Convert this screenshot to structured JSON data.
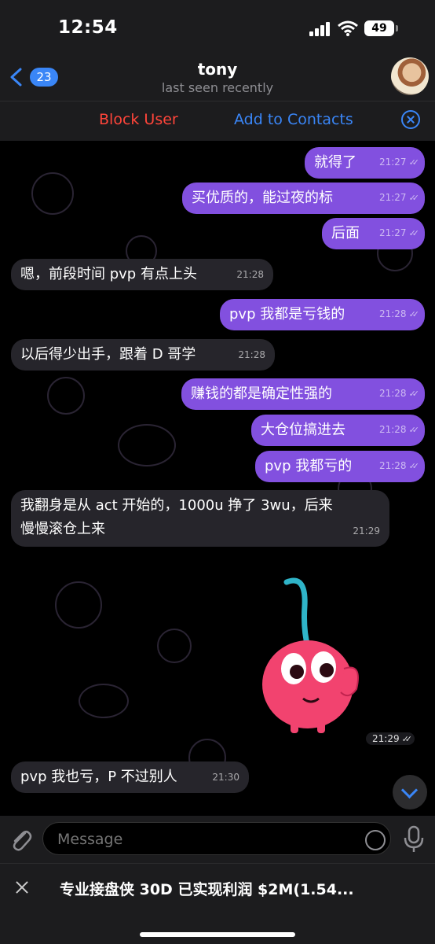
{
  "status": {
    "time": "12:54",
    "battery": "49"
  },
  "header": {
    "back_count": "23",
    "name": "tony",
    "last_seen": "last seen recently"
  },
  "actions": {
    "block": "Block User",
    "add": "Add to Contacts"
  },
  "messages": [
    {
      "dir": "out",
      "text": "就得了",
      "time": "21:27"
    },
    {
      "dir": "out",
      "text": "买优质的，能过夜的标",
      "time": "21:27"
    },
    {
      "dir": "out",
      "text": "后面",
      "time": "21:27"
    },
    {
      "dir": "in",
      "text": "嗯，前段时间 pvp 有点上头",
      "time": "21:28"
    },
    {
      "dir": "out",
      "text": "pvp 我都是亏钱的",
      "time": "21:28"
    },
    {
      "dir": "in",
      "text": "以后得少出手，跟着 D 哥学",
      "time": "21:28"
    },
    {
      "dir": "out",
      "text": "赚钱的都是确定性强的",
      "time": "21:28"
    },
    {
      "dir": "out",
      "text": "大仓位搞进去",
      "time": "21:28"
    },
    {
      "dir": "out",
      "text": "pvp 我都亏的",
      "time": "21:28"
    },
    {
      "dir": "in",
      "text": "我翻身是从 act 开始的，1000u 挣了 3wu，后来",
      "text2": "慢慢滚仓上来",
      "time": "21:29"
    },
    {
      "dir": "in",
      "text": "pvp 我也亏，P 不过别人",
      "time": "21:30"
    }
  ],
  "sticker": {
    "time": "21:29",
    "icon": "cherry-sticker"
  },
  "input": {
    "placeholder": "Message"
  },
  "pinned": {
    "text": "专业接盘侠 30D 已实现利润 $2M(1.54..."
  },
  "colors": {
    "outgoing": "#8250df",
    "incoming": "#26252b",
    "accent": "#3a86f7",
    "danger": "#ff453a"
  }
}
